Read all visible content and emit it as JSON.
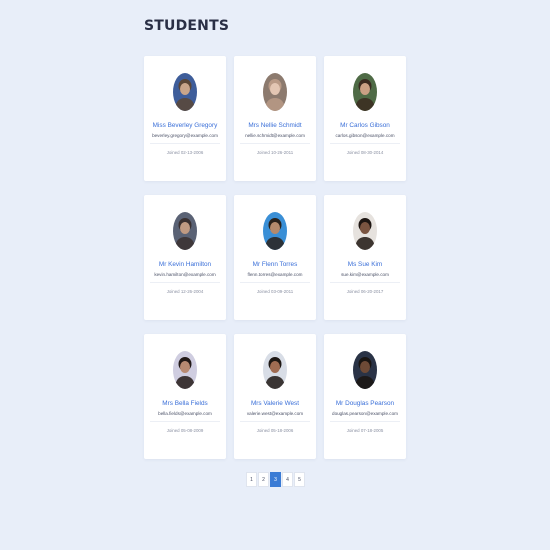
{
  "page": {
    "title": "STUDENTS"
  },
  "students": [
    {
      "name": "Miss Beverley Gregory",
      "email": "beverley.gregory@example.com",
      "joined": "Joined 02-13-2006",
      "avatar_colors": [
        "#3e5d9a",
        "#c9a58a",
        "#5a4636"
      ]
    },
    {
      "name": "Mrs Nellie Schmidt",
      "email": "nellie.schmidt@example.com",
      "joined": "Joined 10-26-2011",
      "avatar_colors": [
        "#8c7a6e",
        "#e3c6b3",
        "#b99a86"
      ]
    },
    {
      "name": "Mr Carlos Gibson",
      "email": "carlos.gibson@example.com",
      "joined": "Joined 08-30-2014",
      "avatar_colors": [
        "#4f6b46",
        "#caa084",
        "#3a2a20"
      ]
    },
    {
      "name": "Mr Kevin Hamilton",
      "email": "kevin.hamilton@example.com",
      "joined": "Joined 12-26-2004",
      "avatar_colors": [
        "#5a6275",
        "#c09a82",
        "#3a3030"
      ]
    },
    {
      "name": "Mr Flenn Torres",
      "email": "flenn.torres@example.com",
      "joined": "Joined 03-09-2011",
      "avatar_colors": [
        "#3a8fd6",
        "#b58a6c",
        "#2a221c"
      ]
    },
    {
      "name": "Ms Sue Kim",
      "email": "sue.kim@example.com",
      "joined": "Joined 06-20-2017",
      "avatar_colors": [
        "#e6e2de",
        "#7a5440",
        "#1e1612"
      ]
    },
    {
      "name": "Mrs Bella Fields",
      "email": "bella.fields@example.com",
      "joined": "Joined 05-08-2009",
      "avatar_colors": [
        "#cfcde0",
        "#b88a72",
        "#231a18"
      ]
    },
    {
      "name": "Mrs Valerie West",
      "email": "valerie.west@example.com",
      "joined": "Joined 05-18-2006",
      "avatar_colors": [
        "#d8dde6",
        "#a06c52",
        "#1f1814"
      ]
    },
    {
      "name": "Mr Douglas Pearson",
      "email": "douglas.pearson@example.com",
      "joined": "Joined 07-18-2005",
      "avatar_colors": [
        "#2a3346",
        "#6e4a36",
        "#1a1512"
      ]
    }
  ],
  "pagination": {
    "pages": [
      "1",
      "2",
      "3",
      "4",
      "5"
    ],
    "active": "3"
  },
  "colors": {
    "background": "#e8eef9",
    "accent": "#3a7bd5",
    "name_link": "#3a6fd8"
  }
}
